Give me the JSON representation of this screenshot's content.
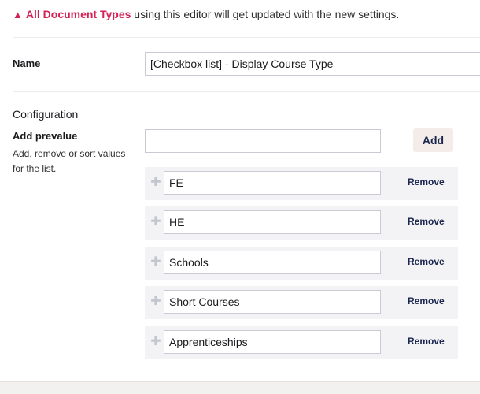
{
  "warning": {
    "icon": "warning-icon",
    "link_text": "All Document Types",
    "text": " using this editor will get updated with the new settings."
  },
  "name_field": {
    "label": "Name",
    "value": "[Checkbox list] - Display Course Type"
  },
  "configuration": {
    "heading": "Configuration",
    "add_prevalue_label": "Add prevalue",
    "add_prevalue_description": "Add, remove or sort values for the list.",
    "new_value": "",
    "add_button": "Add",
    "items": [
      {
        "value": "FE",
        "remove_label": "Remove"
      },
      {
        "value": "HE",
        "remove_label": "Remove"
      },
      {
        "value": "Schools",
        "remove_label": "Remove"
      },
      {
        "value": "Short Courses",
        "remove_label": "Remove"
      },
      {
        "value": "Apprenticeships",
        "remove_label": "Remove"
      }
    ]
  },
  "colors": {
    "accent": "#d42054",
    "navy": "#1b264f",
    "row_bg": "#f3f3f5",
    "button_bg": "#f3ece9"
  }
}
